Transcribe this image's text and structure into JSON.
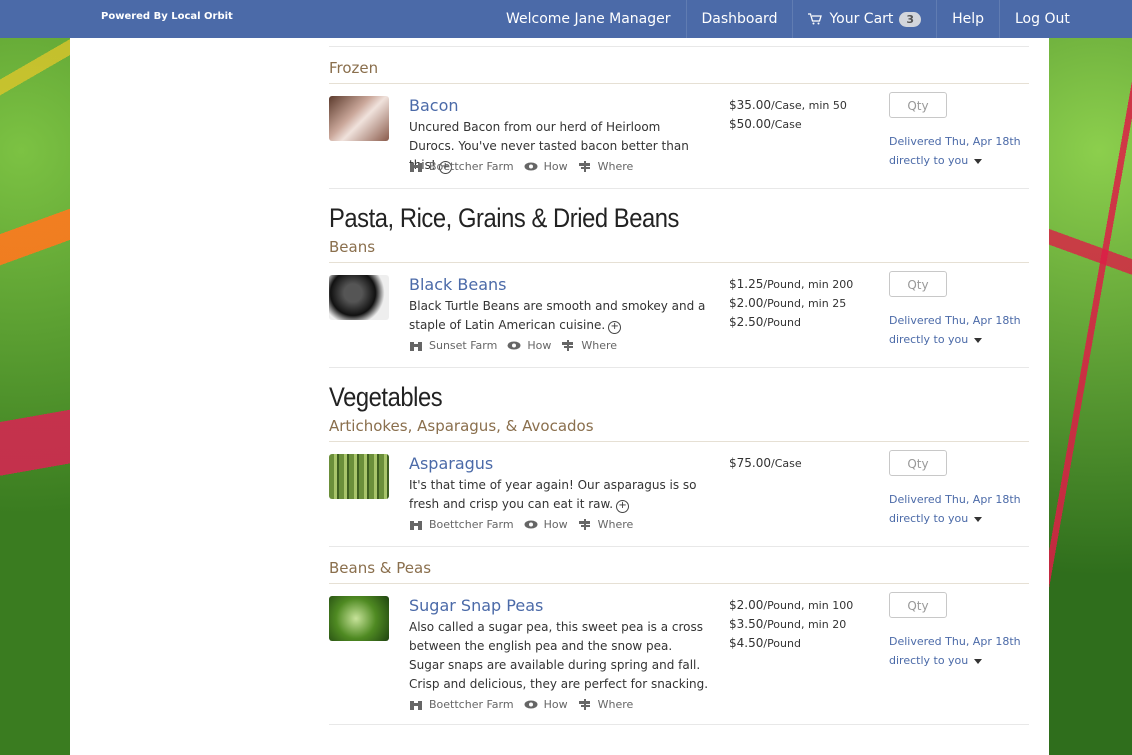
{
  "brand": "Powered By Local Orbit",
  "nav": {
    "welcome": "Welcome Jane Manager",
    "dashboard": "Dashboard",
    "cart": "Your Cart",
    "cart_count": "3",
    "help": "Help",
    "logout": "Log Out"
  },
  "labels": {
    "how": "How",
    "where": "Where",
    "qty": "Qty"
  },
  "sections": [
    {
      "title": "",
      "subcategories": [
        {
          "name": "Frozen",
          "products": [
            {
              "name": "Bacon",
              "description": "Uncured Bacon from our herd of Heirloom Durocs. You've never tasted bacon better than this!",
              "farm": "Boettcher Farm",
              "prices": [
                {
                  "amount": "$35.00",
                  "unit": "/Case, min 50"
                },
                {
                  "amount": "$50.00",
                  "unit": "/Case"
                }
              ],
              "delivery": "Delivered Thu, Apr 18th",
              "delivery_method": "directly to you"
            }
          ]
        }
      ]
    },
    {
      "title": "Pasta, Rice, Grains & Dried Beans",
      "subcategories": [
        {
          "name": "Beans",
          "products": [
            {
              "name": "Black Beans",
              "description": "Black Turtle Beans are smooth and smokey and a staple of Latin American cuisine.",
              "farm": "Sunset Farm",
              "prices": [
                {
                  "amount": "$1.25",
                  "unit": "/Pound, min 200"
                },
                {
                  "amount": "$2.00",
                  "unit": "/Pound, min 25"
                },
                {
                  "amount": "$2.50",
                  "unit": "/Pound"
                }
              ],
              "delivery": "Delivered Thu, Apr 18th",
              "delivery_method": "directly to you"
            }
          ]
        }
      ]
    },
    {
      "title": "Vegetables",
      "subcategories": [
        {
          "name": "Artichokes, Asparagus, & Avocados",
          "products": [
            {
              "name": "Asparagus",
              "description": "It's that time of year again! Our asparagus is so fresh and crisp you can eat it raw.",
              "farm": "Boettcher Farm",
              "prices": [
                {
                  "amount": "$75.00",
                  "unit": "/Case"
                }
              ],
              "delivery": "Delivered Thu, Apr 18th",
              "delivery_method": "directly to you"
            }
          ]
        },
        {
          "name": "Beans & Peas",
          "products": [
            {
              "name": "Sugar Snap Peas",
              "description": "Also called a sugar pea, this sweet pea is a cross between the english pea and the snow pea. Sugar snaps are available during spring and fall. Crisp and delicious, they are perfect for snacking.",
              "farm": "Boettcher Farm",
              "prices": [
                {
                  "amount": "$2.00",
                  "unit": "/Pound, min 100"
                },
                {
                  "amount": "$3.50",
                  "unit": "/Pound, min 20"
                },
                {
                  "amount": "$4.50",
                  "unit": "/Pound"
                }
              ],
              "delivery": "Delivered Thu, Apr 18th",
              "delivery_method": "directly to you"
            }
          ]
        }
      ]
    }
  ],
  "colors": {
    "nav_bg": "#4b6aa8",
    "link": "#4b6aa8",
    "subcategory": "#8a6f4d"
  },
  "icons": {
    "cart": "cart-icon",
    "farm": "binoculars-icon",
    "how": "eye-icon",
    "where": "signpost-icon",
    "more": "plus-circle-icon",
    "dropdown": "caret-down-icon"
  }
}
